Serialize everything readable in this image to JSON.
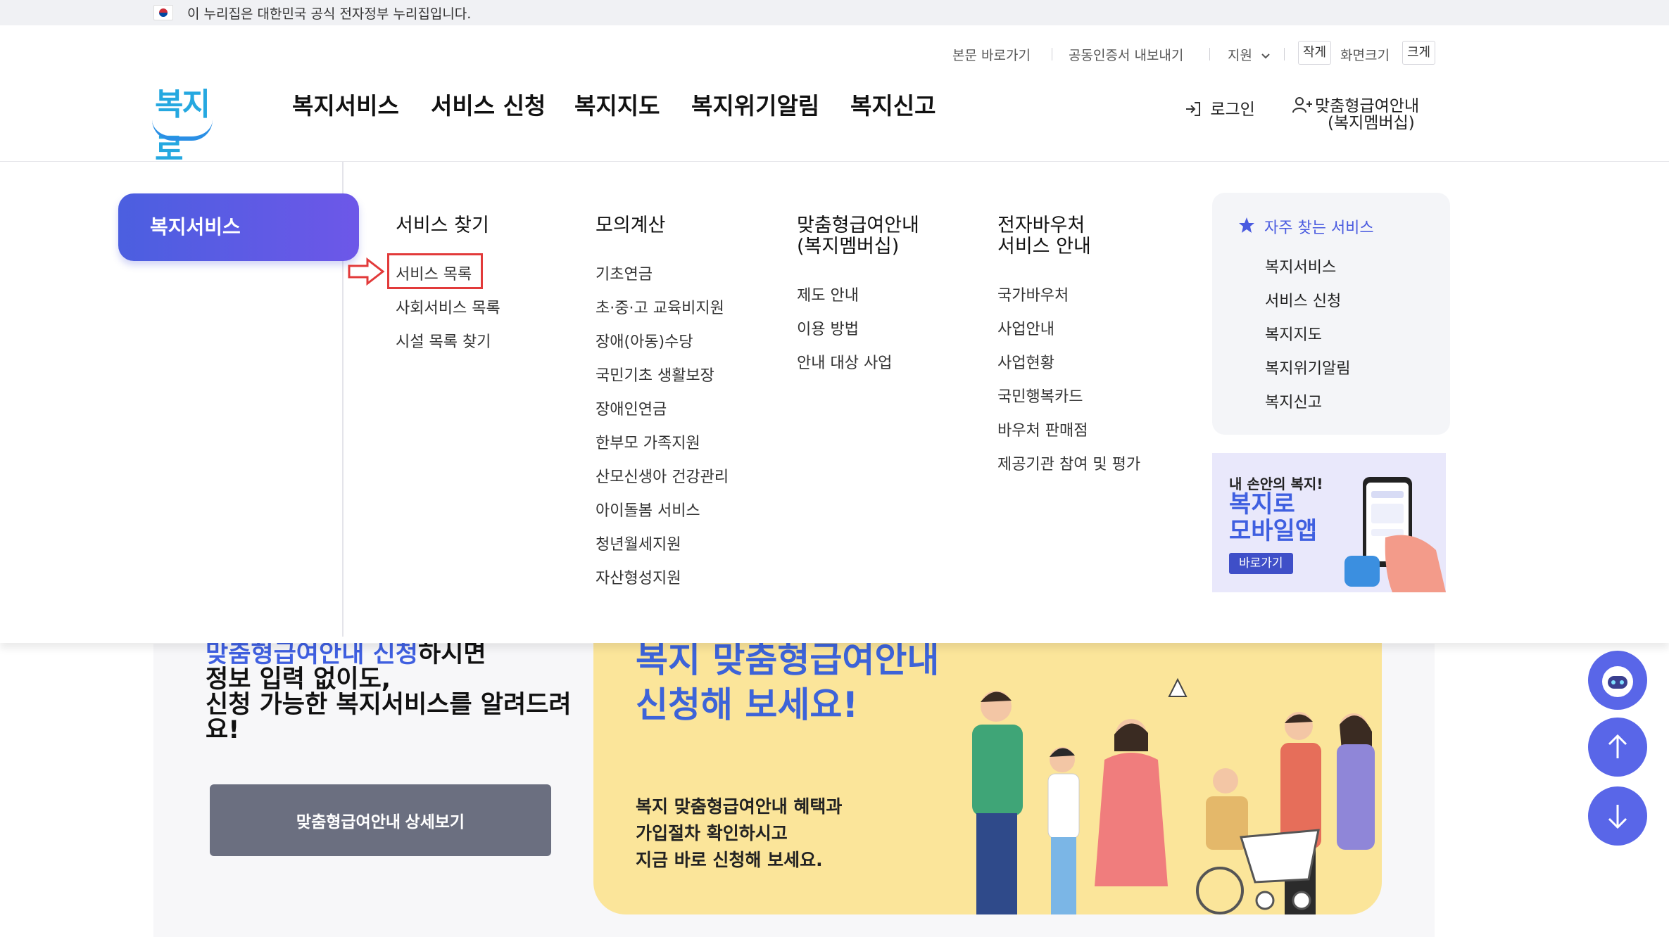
{
  "gov_bar": {
    "text": "이 누리집은 대한민국 공식 전자정부 누리집입니다."
  },
  "utility": {
    "skip": "본문 바로가기",
    "cert": "공동인증서 내보내기",
    "support": "지원",
    "small": "작게",
    "size_label": "화면크기",
    "large": "크게"
  },
  "logo": {
    "text": "복지로"
  },
  "gnb": [
    "복지서비스",
    "서비스 신청",
    "복지지도",
    "복지위기알림",
    "복지신고"
  ],
  "account": {
    "login": "로그인",
    "member_line1": "맞춤형급여안내",
    "member_line2": "(복지멤버십)"
  },
  "mega": {
    "active": "복지서비스",
    "columns": [
      {
        "title": "서비스 찾기",
        "items": [
          "서비스 목록",
          "사회서비스 목록",
          "시설 목록 찾기"
        ]
      },
      {
        "title": "모의계산",
        "items": [
          "기초연금",
          "초·중·고 교육비지원",
          "장애(아동)수당",
          "국민기초 생활보장",
          "장애인연금",
          "한부모 가족지원",
          "산모신생아 건강관리",
          "아이돌봄 서비스",
          "청년월세지원",
          "자산형성지원"
        ]
      },
      {
        "title_line1": "맞춤형급여안내",
        "title_line2": "(복지멤버십)",
        "items": [
          "제도 안내",
          "이용 방법",
          "안내 대상 사업"
        ]
      },
      {
        "title_line1": "전자바우처",
        "title_line2": "서비스 안내",
        "items": [
          "국가바우처",
          "사업안내",
          "사업현황",
          "국민행복카드",
          "바우처 판매점",
          "제공기관 참여 및 평가"
        ]
      }
    ],
    "favorites": {
      "title": "자주 찾는 서비스",
      "items": [
        "복지서비스",
        "서비스 신청",
        "복지지도",
        "복지위기알림",
        "복지신고"
      ]
    },
    "app_banner": {
      "small": "내 손안의 복지!",
      "big_line1": "복지로",
      "big_line2": "모바일앱",
      "button": "바로가기"
    }
  },
  "promo": {
    "highlight": "맞춤형급여안내 신청",
    "rest1": "하시면",
    "line2": "정보 입력 없이도,",
    "line3": "신청 가능한 복지서비스를 알려드려",
    "line4": "요!",
    "button": "맞춤형급여안내 상세보기"
  },
  "banner": {
    "title_line1": "복지 맞춤형급여안내",
    "title_line2": "신청해 보세요!",
    "desc_line1": "복지 맞춤형급여안내 혜택과",
    "desc_line2": "가입절차 확인하시고",
    "desc_line3": "지금 바로 신청해 보세요."
  },
  "colors": {
    "accent": "#4b5fe0",
    "highlight_red": "#e23a3a",
    "banner_yellow": "#fbe59a"
  }
}
